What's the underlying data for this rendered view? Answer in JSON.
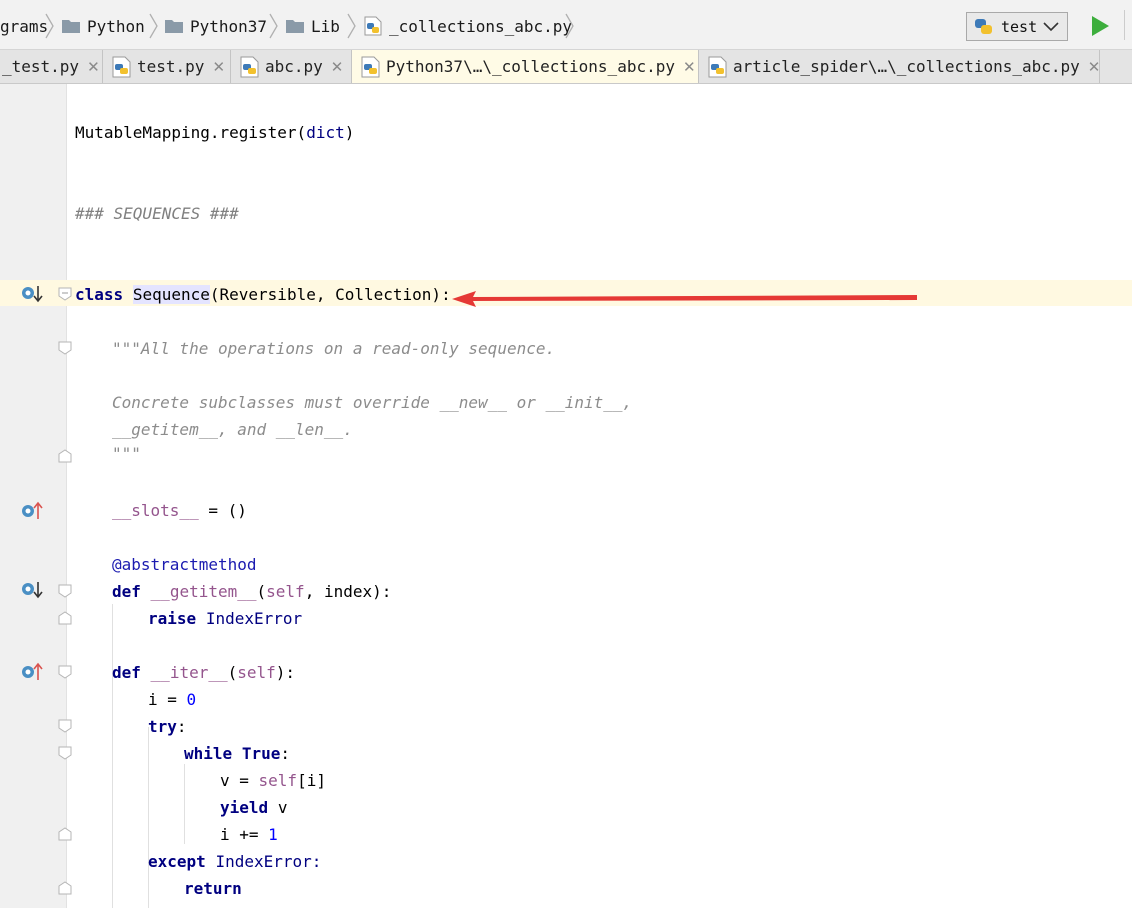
{
  "breadcrumb": [
    "grams",
    "Python",
    "Python37",
    "Lib",
    "_collections_abc.py"
  ],
  "run_config": {
    "label": "test"
  },
  "tabs": [
    {
      "label": "_test.py"
    },
    {
      "label": "test.py"
    },
    {
      "label": "abc.py"
    },
    {
      "label": "Python37\\…\\_collections_abc.py",
      "active": true
    },
    {
      "label": "article_spider\\…\\_collections_abc.py"
    }
  ],
  "code": {
    "l01": {
      "obj": "MutableMapping",
      "method": ".register(",
      "arg": "dict",
      "end": ")"
    },
    "l02": {
      "comment": "### SEQUENCES ###"
    },
    "l03": {
      "kw": "class",
      "name": "Sequence",
      "rest": "(Reversible, Collection):"
    },
    "l04": {
      "text": "\"\"\"All the operations on a read-only sequence."
    },
    "l05": {
      "text": "Concrete subclasses must override __new__ or __init__,"
    },
    "l06": {
      "text": "__getitem__, and __len__."
    },
    "l07": {
      "text": "\"\"\""
    },
    "l08": {
      "name": "__slots__",
      "rest": " = ()"
    },
    "l09": {
      "text": "@abstractmethod"
    },
    "l10": {
      "kw": "def",
      "name": "__getitem__",
      "self": "self",
      "rest": ", index):"
    },
    "l11": {
      "kw": "raise",
      "rest": "IndexError"
    },
    "l12": {
      "kw": "def",
      "name": "__iter__",
      "self": "self",
      "rest": "):"
    },
    "l13": {
      "pre": "i = ",
      "num": "0"
    },
    "l14": {
      "kw": "try",
      "rest": ":"
    },
    "l15": {
      "kw": "while",
      "kw2": "True",
      "rest": ":"
    },
    "l16": {
      "pre": "v = ",
      "self": "self",
      "rest": "[i]"
    },
    "l17": {
      "kw": "yield",
      "rest": "v"
    },
    "l18": {
      "pre": "i += ",
      "num": "1"
    },
    "l19": {
      "kw": "except",
      "rest": "IndexError:"
    },
    "l20": {
      "kw": "return"
    }
  },
  "icons": {
    "breadcrumb_separator": "chevron-right-icon",
    "folder": "folder-icon",
    "python_file": "python-file-icon",
    "dropdown": "chevron-down-icon",
    "run": "run-triangle-icon",
    "close": "close-icon",
    "implemented": "implemented-method-down-icon",
    "overrides": "overrides-method-up-icon",
    "fold": "fold-marker-icon",
    "annotation_arrow": "red-arrow-icon"
  },
  "colors": {
    "keyword": "#000080",
    "comment": "#808080",
    "self": "#94558d",
    "number": "#0000ff",
    "caret_line": "#fff9e1",
    "active_tab": "#fffbe6",
    "run_green": "#3dae3d",
    "annotation_arrow": "#e53935"
  }
}
